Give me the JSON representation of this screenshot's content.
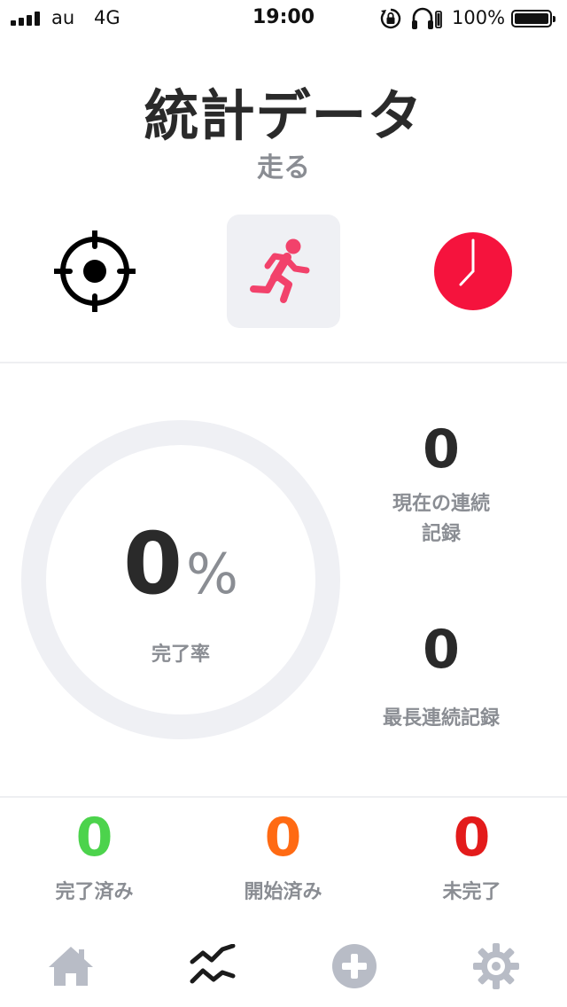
{
  "status_bar": {
    "carrier": "au",
    "network": "4G",
    "time": "19:00",
    "battery_percent": "100%",
    "icons": [
      "signal-icon",
      "orientation-lock-icon",
      "headphones-icon",
      "battery-icon"
    ]
  },
  "header": {
    "title": "統計データ",
    "subtitle": "走る"
  },
  "modes": [
    {
      "icon": "target-icon",
      "selected": false
    },
    {
      "icon": "running-person-icon",
      "selected": true,
      "color": "#f2426b"
    },
    {
      "icon": "clock-icon",
      "selected": false,
      "color": "#f5133d"
    }
  ],
  "completion": {
    "value": "0",
    "unit": "%",
    "fraction": 0,
    "label": "完了率"
  },
  "streaks": {
    "current_value": "0",
    "current_label": "現在の連続\n記録",
    "best_value": "0",
    "best_label": "最長連続記録"
  },
  "counters": [
    {
      "value": "0",
      "label": "完了済み",
      "color": "#4cd34c"
    },
    {
      "value": "0",
      "label": "開始済み",
      "color": "#ff6a13"
    },
    {
      "value": "0",
      "label": "未完了",
      "color": "#e31b1b"
    }
  ],
  "tab_bar": {
    "items": [
      {
        "icon": "home-icon",
        "active": false
      },
      {
        "icon": "stats-chart-icon",
        "active": true
      },
      {
        "icon": "add-circle-icon",
        "active": false
      },
      {
        "icon": "gear-icon",
        "active": false
      }
    ]
  },
  "colors": {
    "accent_pink": "#f2426b",
    "accent_red": "#f5133d",
    "muted_text": "#8a8d93",
    "ring_track": "#eff0f4",
    "inactive_tab": "#b8bcc6"
  }
}
